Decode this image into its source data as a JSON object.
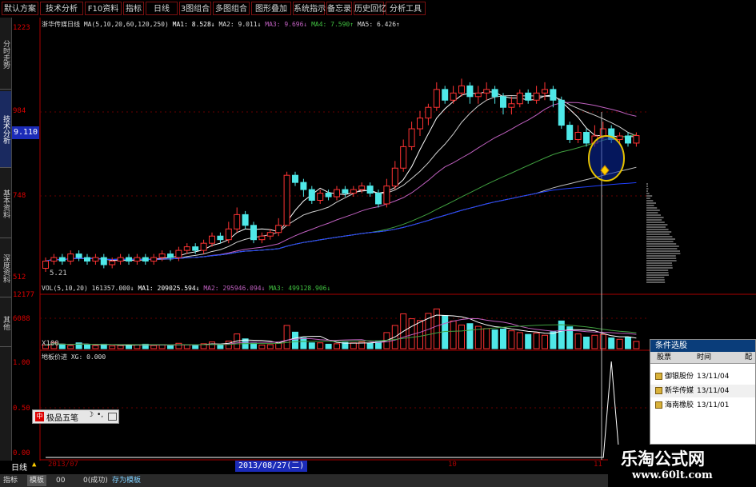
{
  "toolbar": {
    "buttons": [
      "默认方案",
      "技术分析",
      "F10资料",
      "指标",
      "日线",
      "3图组合",
      "多图组合",
      "图形叠加",
      "系统指示",
      "备忘录",
      "历史回忆",
      "分析工具"
    ]
  },
  "left_tabs": [
    "分时走势",
    "技术分析",
    "基本资料",
    "深度资料",
    "其他"
  ],
  "price_label": "9.110",
  "axis": {
    "price_ticks": [
      "1223",
      "984",
      "748",
      "512"
    ],
    "vol_ticks": [
      "12177",
      "6088",
      "X100"
    ],
    "ind_ticks": [
      "1.00",
      "0.50",
      "0.00"
    ],
    "low_label": "5.21"
  },
  "indicators": {
    "main": {
      "stock_name": "浙华传媒日线",
      "ma_params": "MA(5,10,20,60,120,250)",
      "ma1": "MA1: 8.528↓",
      "ma2": "MA2: 9.011↓",
      "ma3": "MA3: 9.696↓",
      "ma4": "MA4: 7.590↑",
      "ma5": "MA5: 6.426↑"
    },
    "vol": {
      "params": "VOL(5,10,20)",
      "vol": "161357.000↓",
      "ma1": "MA1: 209025.594↓",
      "ma2": "MA2: 295946.094↓",
      "ma3": "MA3: 499128.906↓"
    },
    "custom": {
      "name": "地板价进",
      "value": "XG: 0.000"
    }
  },
  "condition_panel": {
    "title": "条件选股",
    "headers": [
      "股票",
      "时间",
      "配"
    ],
    "rows": [
      {
        "name": "御银股份",
        "date": "13/11/04"
      },
      {
        "name": "新华传媒",
        "date": "13/11/04"
      },
      {
        "name": "海南橡胶",
        "date": "13/11/01"
      }
    ]
  },
  "ime": {
    "label": "极品五笔"
  },
  "bottom_axis": {
    "period": "日线",
    "start": "2013/07",
    "cursor_date": "2013/08/27(二)",
    "month1": "10",
    "month2": "11"
  },
  "status_bar": [
    "指标",
    "模板",
    "00",
    "0(成功)",
    "存为模板"
  ],
  "watermark": {
    "title": "乐淘公式网",
    "url": "www.60lt.com"
  },
  "colors": {
    "background": "#000000",
    "up": "#ff3333",
    "down": "#4fe8e8",
    "ma_white": "#ffffff",
    "ma_purple": "#c060c0",
    "ma_green": "#40a040",
    "ma_blue": "#2040ff",
    "axis_red": "#aa0000",
    "highlight_blue": "#1b2bb8"
  },
  "chart_data": {
    "type": "candlestick",
    "price_range": [
      5.12,
      12.23
    ],
    "low": 5.21,
    "candles": [
      [
        5.4,
        5.6,
        5.3,
        5.7
      ],
      [
        5.6,
        5.7,
        5.5,
        5.8
      ],
      [
        5.7,
        5.6,
        5.5,
        5.8
      ],
      [
        5.6,
        5.8,
        5.5,
        5.9
      ],
      [
        5.8,
        5.7,
        5.6,
        5.9
      ],
      [
        5.7,
        5.6,
        5.5,
        5.8
      ],
      [
        5.6,
        5.7,
        5.5,
        5.8
      ],
      [
        5.7,
        5.5,
        5.4,
        5.8
      ],
      [
        5.5,
        5.6,
        5.4,
        5.7
      ],
      [
        5.6,
        5.7,
        5.5,
        5.8
      ],
      [
        5.7,
        5.6,
        5.5,
        5.8
      ],
      [
        5.6,
        5.7,
        5.5,
        5.8
      ],
      [
        5.7,
        5.6,
        5.5,
        5.8
      ],
      [
        5.6,
        5.7,
        5.5,
        5.8
      ],
      [
        5.7,
        5.8,
        5.6,
        5.9
      ],
      [
        5.8,
        5.7,
        5.6,
        5.9
      ],
      [
        5.7,
        5.9,
        5.6,
        6.0
      ],
      [
        5.9,
        6.0,
        5.8,
        6.1
      ],
      [
        6.0,
        5.9,
        5.8,
        6.1
      ],
      [
        5.9,
        6.1,
        5.8,
        6.2
      ],
      [
        6.1,
        6.3,
        6.0,
        6.4
      ],
      [
        6.3,
        6.2,
        6.1,
        6.4
      ],
      [
        6.2,
        6.5,
        6.1,
        6.7
      ],
      [
        6.5,
        6.9,
        6.4,
        7.1
      ],
      [
        6.9,
        6.6,
        6.5,
        7.0
      ],
      [
        6.6,
        6.2,
        6.1,
        6.7
      ],
      [
        6.2,
        6.3,
        6.1,
        6.4
      ],
      [
        6.3,
        6.4,
        6.2,
        6.5
      ],
      [
        6.4,
        6.6,
        6.3,
        6.8
      ],
      [
        6.6,
        8.0,
        6.6,
        8.1
      ],
      [
        8.0,
        7.8,
        7.7,
        8.1
      ],
      [
        7.8,
        7.6,
        7.4,
        7.9
      ],
      [
        7.6,
        7.3,
        7.2,
        7.7
      ],
      [
        7.3,
        7.5,
        7.2,
        7.6
      ],
      [
        7.5,
        7.4,
        7.3,
        7.6
      ],
      [
        7.4,
        7.6,
        7.3,
        7.7
      ],
      [
        7.6,
        7.5,
        7.4,
        7.7
      ],
      [
        7.5,
        7.6,
        7.4,
        7.7
      ],
      [
        7.6,
        7.7,
        7.5,
        7.8
      ],
      [
        7.7,
        7.5,
        7.4,
        7.8
      ],
      [
        7.5,
        7.2,
        7.1,
        7.6
      ],
      [
        7.2,
        7.7,
        7.1,
        7.9
      ],
      [
        7.7,
        8.2,
        7.6,
        8.4
      ],
      [
        8.2,
        8.8,
        8.1,
        9.0
      ],
      [
        8.8,
        9.3,
        8.7,
        9.5
      ],
      [
        9.3,
        9.6,
        9.1,
        9.8
      ],
      [
        9.6,
        9.9,
        9.4,
        10.0
      ],
      [
        9.9,
        10.4,
        9.8,
        10.6
      ],
      [
        10.4,
        10.1,
        10.0,
        10.5
      ],
      [
        10.1,
        10.3,
        10.0,
        10.5
      ],
      [
        10.3,
        10.5,
        10.2,
        10.7
      ],
      [
        10.5,
        10.2,
        10.0,
        10.6
      ],
      [
        10.2,
        10.3,
        10.0,
        10.5
      ],
      [
        10.3,
        10.4,
        10.1,
        10.6
      ],
      [
        10.4,
        10.2,
        10.0,
        10.5
      ],
      [
        10.2,
        9.9,
        9.7,
        10.3
      ],
      [
        9.9,
        10.0,
        9.7,
        10.2
      ],
      [
        10.0,
        10.3,
        9.9,
        10.4
      ],
      [
        10.3,
        10.1,
        10.0,
        10.4
      ],
      [
        10.1,
        10.3,
        10.0,
        10.5
      ],
      [
        10.3,
        10.4,
        10.1,
        10.6
      ],
      [
        10.4,
        10.1,
        9.9,
        10.5
      ],
      [
        10.1,
        9.4,
        9.3,
        10.2
      ],
      [
        9.4,
        9.0,
        8.9,
        9.5
      ],
      [
        9.0,
        9.2,
        8.9,
        9.4
      ],
      [
        9.2,
        8.9,
        8.8,
        9.3
      ],
      [
        8.9,
        9.1,
        8.8,
        9.4
      ],
      [
        9.1,
        9.3,
        9.0,
        9.5
      ],
      [
        9.3,
        9.0,
        8.9,
        9.4
      ],
      [
        9.0,
        9.1,
        8.9,
        9.2
      ],
      [
        9.1,
        8.9,
        8.8,
        9.2
      ],
      [
        8.9,
        9.11,
        8.8,
        9.2
      ]
    ],
    "volume_range": [
      0,
      12177
    ],
    "volumes": [
      800,
      1400,
      900,
      700,
      1300,
      900,
      700,
      1000,
      600,
      700,
      900,
      800,
      1000,
      700,
      900,
      700,
      1200,
      900,
      700,
      1100,
      1500,
      1000,
      1700,
      3300,
      2200,
      1200,
      800,
      900,
      1200,
      5200,
      3700,
      2400,
      1300,
      1300,
      1000,
      1100,
      1400,
      1300,
      1500,
      1200,
      1600,
      3600,
      5200,
      7800,
      6700,
      6300,
      7900,
      8900,
      7400,
      6200,
      5300,
      5600,
      5000,
      4500,
      4200,
      4400,
      4000,
      3600,
      3200,
      3500,
      3000,
      3800,
      6200,
      4900,
      3300,
      2600,
      3000,
      3200,
      2400,
      2100,
      2600,
      1613
    ],
    "indicator_signal_index": 68
  }
}
